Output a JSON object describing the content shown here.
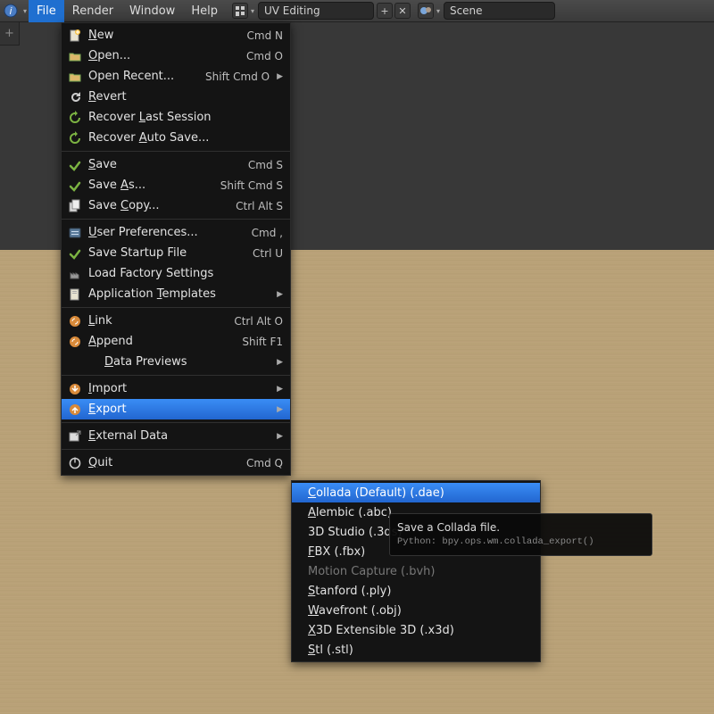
{
  "topbar": {
    "menus": [
      {
        "label": "File",
        "active": true
      },
      {
        "label": "Render",
        "active": false
      },
      {
        "label": "Window",
        "active": false
      },
      {
        "label": "Help",
        "active": false
      }
    ],
    "layout_field": "UV Editing",
    "scene_field": "Scene"
  },
  "file_menu": {
    "sections": [
      [
        {
          "id": "new",
          "label": "New",
          "underline": "N",
          "shortcut": "Cmd N",
          "icon": "doc-new"
        },
        {
          "id": "open",
          "label": "Open...",
          "underline": "O",
          "shortcut": "Cmd O",
          "icon": "folder"
        },
        {
          "id": "open-recent",
          "label": "Open Recent...",
          "underline": "",
          "shortcut": "Shift Cmd O",
          "icon": "folder",
          "submenu": true
        },
        {
          "id": "revert",
          "label": "Revert",
          "underline": "R",
          "shortcut": "",
          "icon": "revert"
        },
        {
          "id": "recover-last",
          "label": "Recover Last Session",
          "underline": "L",
          "shortcut": "",
          "icon": "recover"
        },
        {
          "id": "recover-auto",
          "label": "Recover Auto Save...",
          "underline": "A",
          "shortcut": "",
          "icon": "recover"
        }
      ],
      [
        {
          "id": "save",
          "label": "Save",
          "underline": "S",
          "shortcut": "Cmd S",
          "icon": "save"
        },
        {
          "id": "save-as",
          "label": "Save As...",
          "underline": "A",
          "shortcut": "Shift Cmd S",
          "icon": "save"
        },
        {
          "id": "save-copy",
          "label": "Save Copy...",
          "underline": "C",
          "shortcut": "Ctrl Alt S",
          "icon": "save-copy"
        }
      ],
      [
        {
          "id": "user-prefs",
          "label": "User Preferences...",
          "underline": "U",
          "shortcut": "Cmd ,",
          "icon": "prefs"
        },
        {
          "id": "save-startup",
          "label": "Save Startup File",
          "underline": "",
          "shortcut": "Ctrl U",
          "icon": "save"
        },
        {
          "id": "load-factory",
          "label": "Load Factory Settings",
          "underline": "",
          "shortcut": "",
          "icon": "factory"
        },
        {
          "id": "app-templates",
          "label": "Application Templates",
          "underline": "T",
          "shortcut": "",
          "icon": "templates",
          "submenu": true
        }
      ],
      [
        {
          "id": "link",
          "label": "Link",
          "underline": "L",
          "shortcut": "Ctrl Alt O",
          "icon": "link"
        },
        {
          "id": "append",
          "label": "Append",
          "underline": "A",
          "shortcut": "Shift F1",
          "icon": "link"
        },
        {
          "id": "data-previews",
          "label": "Data Previews",
          "underline": "D",
          "shortcut": "",
          "icon": "",
          "submenu": true,
          "indent": true
        }
      ],
      [
        {
          "id": "import",
          "label": "Import",
          "underline": "I",
          "shortcut": "",
          "icon": "import",
          "submenu": true
        },
        {
          "id": "export",
          "label": "Export",
          "underline": "E",
          "shortcut": "",
          "icon": "export",
          "submenu": true,
          "highlight": true
        }
      ],
      [
        {
          "id": "external-data",
          "label": "External Data",
          "underline": "E",
          "shortcut": "",
          "icon": "external",
          "submenu": true
        }
      ],
      [
        {
          "id": "quit",
          "label": "Quit",
          "underline": "Q",
          "shortcut": "Cmd Q",
          "icon": "power"
        }
      ]
    ]
  },
  "export_submenu": [
    {
      "id": "collada",
      "label": "Collada (Default) (.dae)",
      "underline": "C",
      "highlight": true
    },
    {
      "id": "alembic",
      "label": "Alembic (.abc)",
      "underline": "A"
    },
    {
      "id": "3ds",
      "label": "3D Studio (.3ds)",
      "underline": ""
    },
    {
      "id": "fbx",
      "label": "FBX (.fbx)",
      "underline": "F"
    },
    {
      "id": "bvh",
      "label": "Motion Capture (.bvh)",
      "underline": "",
      "disabled": true
    },
    {
      "id": "ply",
      "label": "Stanford (.ply)",
      "underline": "S"
    },
    {
      "id": "obj",
      "label": "Wavefront (.obj)",
      "underline": "W"
    },
    {
      "id": "x3d",
      "label": "X3D Extensible 3D (.x3d)",
      "underline": "X"
    },
    {
      "id": "stl",
      "label": "Stl (.stl)",
      "underline": "S"
    }
  ],
  "tooltip": {
    "title": "Save a Collada file.",
    "python": "Python: bpy.ops.wm.collada_export()"
  }
}
